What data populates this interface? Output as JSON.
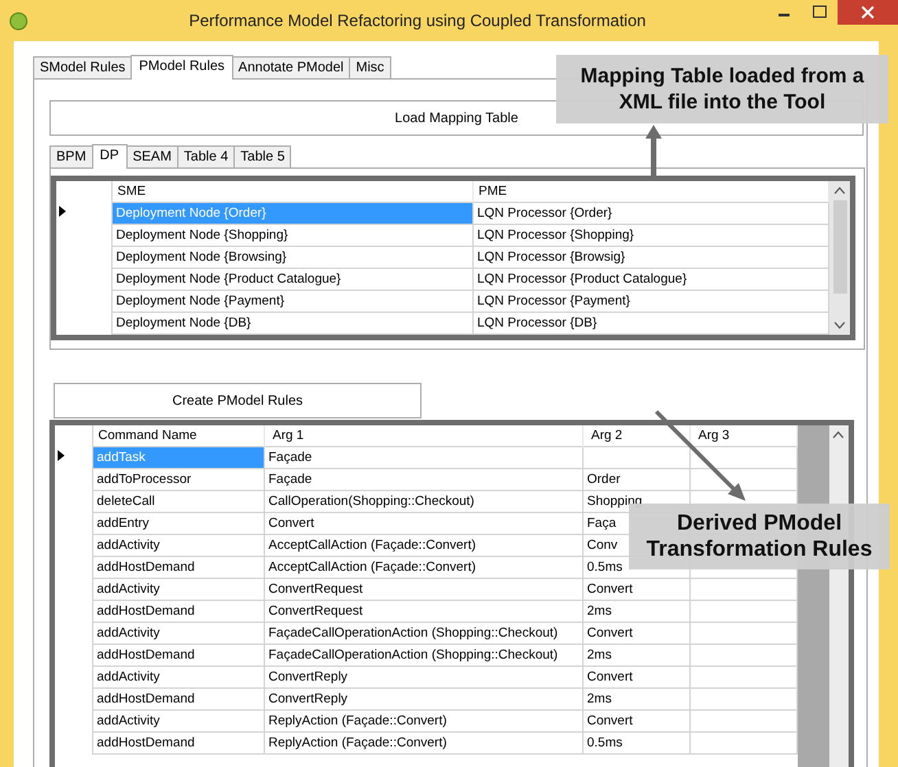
{
  "window": {
    "title": "Performance Model Refactoring using Coupled Transformation"
  },
  "tabs": [
    {
      "label": "SModel Rules",
      "selected": false
    },
    {
      "label": "PModel Rules",
      "selected": true
    },
    {
      "label": "Annotate PModel",
      "selected": false
    },
    {
      "label": "Misc",
      "selected": false
    }
  ],
  "load_button": "Load Mapping Table",
  "inner_tabs": [
    {
      "label": "BPM",
      "selected": false
    },
    {
      "label": "DP",
      "selected": true
    },
    {
      "label": "SEAM",
      "selected": false
    },
    {
      "label": "Table 4",
      "selected": false
    },
    {
      "label": "Table 5",
      "selected": false
    }
  ],
  "mapping_table": {
    "columns": [
      "SME",
      "PME"
    ],
    "rows": [
      {
        "cells": [
          "Deployment Node  {Order}",
          "LQN Processor {Order}"
        ],
        "selected": true
      },
      {
        "cells": [
          "Deployment Node  {Shopping}",
          "LQN Processor {Shopping}"
        ],
        "selected": false
      },
      {
        "cells": [
          "Deployment Node  {Browsing}",
          "LQN Processor {Browsig}"
        ],
        "selected": false
      },
      {
        "cells": [
          "Deployment Node {Product Catalogue}",
          "LQN Processor {Product Catalogue}"
        ],
        "selected": false
      },
      {
        "cells": [
          "Deployment Node {Payment}",
          "LQN Processor {Payment}"
        ],
        "selected": false
      },
      {
        "cells": [
          "Deployment Node {DB}",
          "LQN Processor {DB}"
        ],
        "selected": false
      }
    ]
  },
  "create_button": "Create PModel Rules",
  "rules_table": {
    "columns": [
      "Command Name",
      "Arg 1",
      "Arg 2",
      "Arg 3"
    ],
    "rows": [
      {
        "cells": [
          "addTask",
          "Façade",
          "",
          ""
        ],
        "selected": true
      },
      {
        "cells": [
          "addToProcessor",
          "Façade",
          "Order",
          ""
        ],
        "selected": false
      },
      {
        "cells": [
          "deleteCall",
          "CallOperation(Shopping::Checkout)",
          "Shopping",
          ""
        ],
        "selected": false
      },
      {
        "cells": [
          "addEntry",
          "Convert",
          "Faça",
          ""
        ],
        "selected": false
      },
      {
        "cells": [
          "addActivity",
          "AcceptCallAction (Façade::Convert)",
          "Conv",
          ""
        ],
        "selected": false
      },
      {
        "cells": [
          "addHostDemand",
          "AcceptCallAction (Façade::Convert)",
          "0.5ms",
          ""
        ],
        "selected": false
      },
      {
        "cells": [
          "addActivity",
          "ConvertRequest",
          "Convert",
          ""
        ],
        "selected": false
      },
      {
        "cells": [
          "addHostDemand",
          "ConvertRequest",
          "2ms",
          ""
        ],
        "selected": false
      },
      {
        "cells": [
          "addActivity",
          "FaçadeCallOperationAction (Shopping::Checkout)",
          "Convert",
          ""
        ],
        "selected": false
      },
      {
        "cells": [
          "addHostDemand",
          "FaçadeCallOperationAction (Shopping::Checkout)",
          "2ms",
          ""
        ],
        "selected": false
      },
      {
        "cells": [
          "addActivity",
          "ConvertReply",
          "Convert",
          ""
        ],
        "selected": false
      },
      {
        "cells": [
          "addHostDemand",
          "ConvertReply",
          "2ms",
          ""
        ],
        "selected": false
      },
      {
        "cells": [
          "addActivity",
          "ReplyAction (Façade::Convert)",
          "Convert",
          ""
        ],
        "selected": false
      },
      {
        "cells": [
          "addHostDemand",
          "ReplyAction (Façade::Convert)",
          "0.5ms",
          ""
        ],
        "selected": false
      }
    ]
  },
  "callouts": [
    {
      "lines": [
        "Mapping Table loaded from a",
        "XML file into the Tool"
      ]
    },
    {
      "lines": [
        "Derived PModel",
        "Transformation Rules"
      ]
    }
  ]
}
